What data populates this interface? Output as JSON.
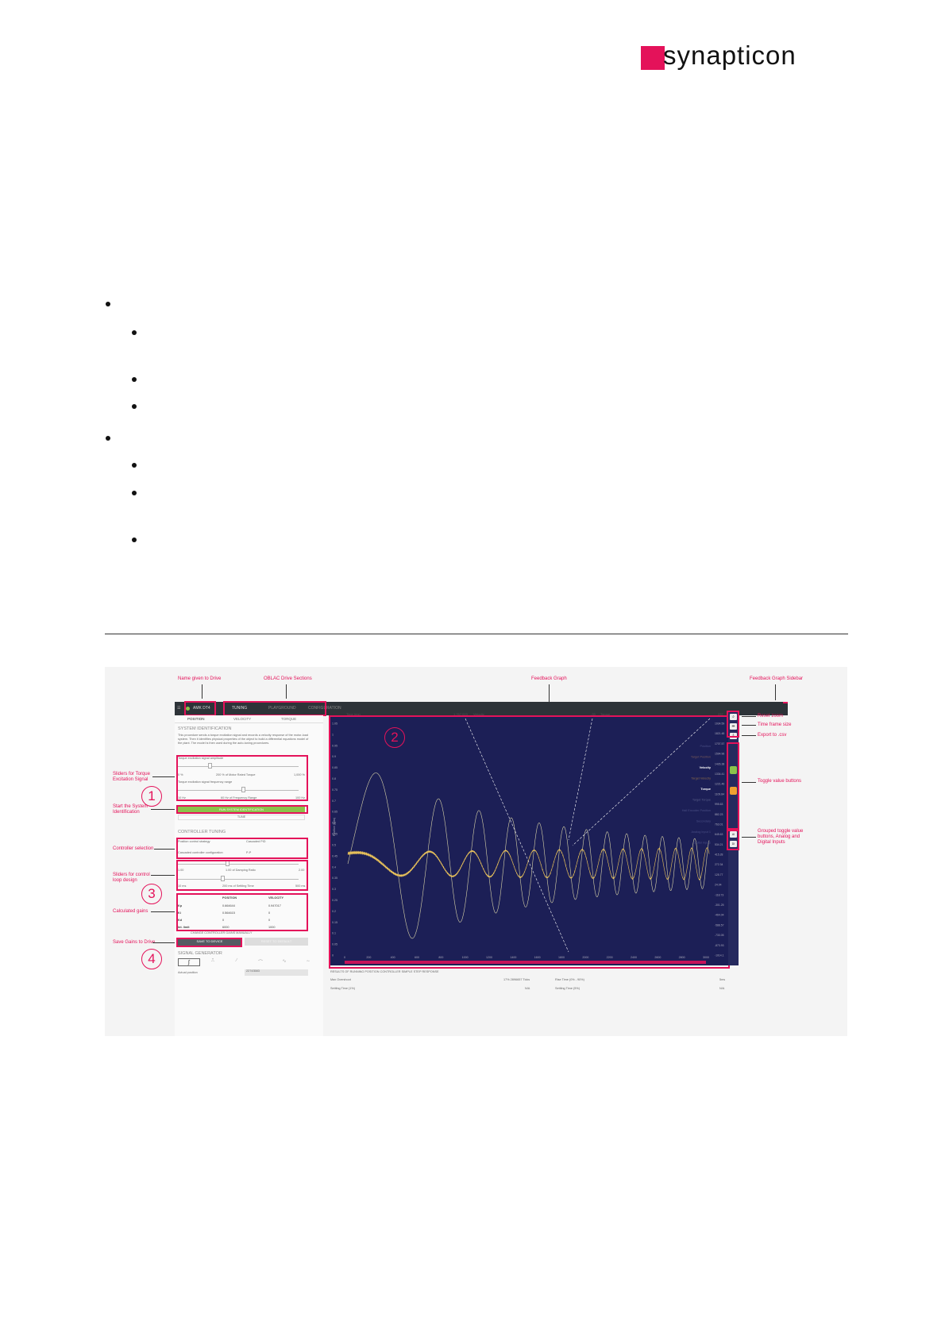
{
  "brand": {
    "name": "synapticon",
    "accent": "#e4125a"
  },
  "figure": {
    "annotations": {
      "name_given": "Name given to Drive",
      "oblac_sections": "OBLAC Drive Sections",
      "feedback_graph": "Feedback Graph",
      "feedback_sidebar": "Feedback Graph Sidebar",
      "sliders_torque": "Sliders for Torque\nExcitation Signal",
      "start_sysid": "Start the System\nIdentification",
      "controller_selection": "Controller selection",
      "sliders_control": "Sliders for control\nloop design",
      "calculated_gains": "Calculated gains",
      "save_gains": "Save Gains to Drive",
      "reset_zoom": "Reset zoom",
      "time_frame": "Time frame size",
      "export_csv": "Export to .csv",
      "toggle_value": "Toggle value\nbuttons",
      "grouped_toggle": "Grouped toggle\nvalue buttons,\nAnalog and Digital\nInputs"
    },
    "numbers": [
      "1",
      "2",
      "3",
      "4"
    ],
    "app": {
      "drive_name": "AMK DT4",
      "sections": [
        "TUNING",
        "PLAYGROUND",
        "CONFIGURATION"
      ],
      "tabs": [
        "POSITION",
        "VELOCITY",
        "TORQUE"
      ],
      "sysid_title": "SYSTEM IDENTIFICATION",
      "sysid_desc": "This procedure sends a torque excitation signal and records a velocity response of the motor-load system. Then it identifies physical properties of the object to build a differential equations model of the plant. The model is then used during the auto-tuning procedures.",
      "amp_label": "Torque excitation signal amplitude",
      "amp_min": "0 %",
      "amp_value": "200 % of Motor Rated Torque",
      "amp_max": "1,000 %",
      "freq_label": "Torque excitation signal frequency range",
      "freq_min": "10 Hz",
      "freq_value": "60 Hz of Frequency Range",
      "freq_max": "100 Hz",
      "run_btn": "RUN SYSTEM IDENTIFICATION",
      "tune_btn": "TUNE",
      "ctrl_title": "CONTROLLER TUNING",
      "strategy_label": "Position control strategy",
      "strategy_value": "Cascaded PID",
      "config_label": "Cascaded controller configuration",
      "config_value": "P-P",
      "damp_min": "1.00",
      "damp_value": "1.00 of Damping Ratio",
      "damp_max": "2.00",
      "settle_min": "10 ms",
      "settle_value": "200 ms of Settling Time",
      "settle_max": "500 ms",
      "gains_headers": [
        "",
        "POSITION",
        "VELOCITY"
      ],
      "gains_rows": [
        [
          "Kp",
          "0.664644",
          "0.947017"
        ],
        [
          "Ki",
          "0.564615",
          "0"
        ],
        [
          "Kd",
          "0",
          "0"
        ],
        [
          "Int. limit",
          "6000",
          "1000"
        ]
      ],
      "change_manual": "CHANGE CONTROLLER GAINS MANUALLY",
      "save_btn": "SAVE TO DEVICE",
      "reset_btn": "RESET TO DEFAULT",
      "siggen_title": "SIGNAL GENERATOR",
      "actual_position_label": "Actual position",
      "actual_position_value": "22743583",
      "graph_header": {
        "time_label": "Time (ms)",
        "velocity_value": "1,767,023",
        "velocity_label": "Velocity",
        "torque_value": "-33",
        "torque_label": "Torque",
        "right_value": "237"
      },
      "y_ticks_left": [
        "1.05",
        "1",
        "0.95",
        "0.9",
        "0.85",
        "0.8",
        "0.75",
        "0.7",
        "0.65",
        "0.6",
        "0.55",
        "0.5",
        "0.45",
        "0.4",
        "0.35",
        "0.3",
        "0.25",
        "0.2",
        "0.15",
        "0.1",
        "0.05",
        "0"
      ],
      "y_ticks_right": [
        "1934.59",
        "1821.48",
        "1707.57",
        "1594.96",
        "1426.38",
        "1334.41",
        "1221.46",
        "1109.84",
        "995.63",
        "882.23",
        "763.01",
        "645.63",
        "534.21",
        "415.28",
        "272.34",
        "125.77",
        "24.04",
        "-118.73",
        "-301.25",
        "-464.04",
        "-588.57",
        "-733.05",
        "-873.93",
        "-1014.1"
      ],
      "x_ticks": [
        "0",
        "200",
        "400",
        "600",
        "800",
        "1000",
        "1200",
        "1400",
        "1600",
        "1800",
        "2000",
        "2200",
        "2400",
        "2600",
        "2800",
        "3000"
      ],
      "y_axis_title": "Position (ticks)",
      "legend": [
        {
          "label": "Position",
          "color": "#4a4f85"
        },
        {
          "label": "Target Position",
          "color": "#7a5a5a"
        },
        {
          "label": "Velocity",
          "color": "#ffffff"
        },
        {
          "label": "Target Velocity",
          "color": "#8a6a4a"
        },
        {
          "label": "Torque",
          "color": "#ffffff"
        },
        {
          "label": "Target Torque",
          "color": "#5a5f8a"
        },
        {
          "label": "Hall Encoder Position",
          "color": "#4a4f85"
        },
        {
          "label": "Secondary",
          "color": "#4a4f85"
        },
        {
          "label": "Analog Input 1",
          "color": "#4a4f85"
        },
        {
          "label": "Digital Inputs",
          "color": "#4a4f85"
        }
      ],
      "sidebar_group_labels": [
        "AI",
        "DI"
      ],
      "results_title": "RESULTS OF RUNNING POSITION CONTROLLER SIMPLE STEP RESPONSE",
      "results": [
        {
          "label": "Max Overshoot",
          "value": "17% 2896657 Ticks"
        },
        {
          "label": "Rise Time (0% - 90%)",
          "value": "5ms"
        },
        {
          "label": "Settling Time (1%)",
          "value": "N/A"
        },
        {
          "label": "Settling Time (5%)",
          "value": "N/A"
        }
      ]
    }
  }
}
